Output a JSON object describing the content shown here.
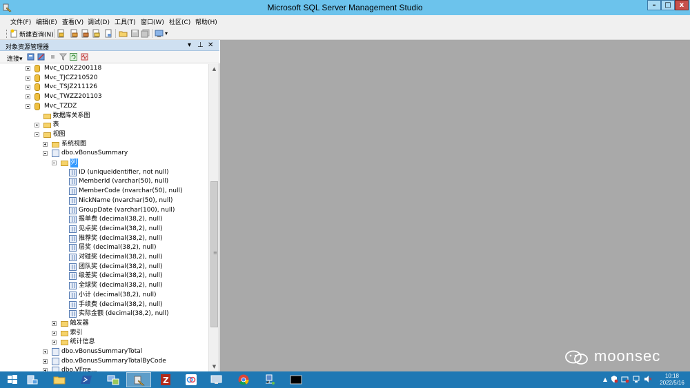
{
  "window": {
    "title": "Microsoft SQL Server Management Studio",
    "minimize_glyph": "–",
    "maximize_glyph": "□",
    "close_glyph": "x"
  },
  "menu": [
    {
      "label": "文件(F)"
    },
    {
      "label": "编辑(E)"
    },
    {
      "label": "查看(V)"
    },
    {
      "label": "调试(D)"
    },
    {
      "label": "工具(T)"
    },
    {
      "label": "窗口(W)"
    },
    {
      "label": "社区(C)"
    },
    {
      "label": "帮助(H)"
    }
  ],
  "toolbar": {
    "new_query_label": "新建查询(N)",
    "overflow_glyph": "▾"
  },
  "object_explorer": {
    "title": "对象资源管理器",
    "pin_glyph": "▾",
    "autohide_glyph": "⊥",
    "close_glyph": "✕",
    "connect_label": "连接▾",
    "tree": [
      {
        "label": "Mvc_QDXZ200118",
        "icon": "database-icon",
        "expander": "plus",
        "level": 0
      },
      {
        "label": "Mvc_TJCZ210520",
        "icon": "database-icon",
        "expander": "plus",
        "level": 0
      },
      {
        "label": "Mvc_TSJZ211126",
        "icon": "database-icon",
        "expander": "plus",
        "level": 0
      },
      {
        "label": "Mvc_TWZZ201103",
        "icon": "database-icon",
        "expander": "plus",
        "level": 0
      },
      {
        "label": "Mvc_TZDZ",
        "icon": "database-icon",
        "expander": "minus",
        "level": 0
      },
      {
        "label": "数据库关系图",
        "icon": "folder-icon",
        "expander": "none",
        "level": 1
      },
      {
        "label": "表",
        "icon": "folder-icon",
        "expander": "plus",
        "level": 1
      },
      {
        "label": "视图",
        "icon": "folder-icon",
        "expander": "minus",
        "level": 1
      },
      {
        "label": "系统视图",
        "icon": "folder-icon",
        "expander": "plus",
        "level": 2
      },
      {
        "label": "dbo.vBonusSummary",
        "icon": "view-icon",
        "expander": "minus",
        "level": 2
      },
      {
        "label": "列",
        "icon": "folder-icon",
        "expander": "minus",
        "level": 3,
        "selected": true
      },
      {
        "label": "ID (uniqueidentifier, not null)",
        "icon": "column-icon",
        "expander": "none",
        "level": 4
      },
      {
        "label": "MemberId (varchar(50), null)",
        "icon": "column-icon",
        "expander": "none",
        "level": 4
      },
      {
        "label": "MemberCode (nvarchar(50), null)",
        "icon": "column-icon",
        "expander": "none",
        "level": 4
      },
      {
        "label": "NickName (nvarchar(50), null)",
        "icon": "column-icon",
        "expander": "none",
        "level": 4
      },
      {
        "label": "GroupDate (varchar(100), null)",
        "icon": "column-icon",
        "expander": "none",
        "level": 4
      },
      {
        "label": "报单费 (decimal(38,2), null)",
        "icon": "column-icon",
        "expander": "none",
        "level": 4
      },
      {
        "label": "见点奖 (decimal(38,2), null)",
        "icon": "column-icon",
        "expander": "none",
        "level": 4
      },
      {
        "label": "推荐奖 (decimal(38,2), null)",
        "icon": "column-icon",
        "expander": "none",
        "level": 4
      },
      {
        "label": "层奖 (decimal(38,2), null)",
        "icon": "column-icon",
        "expander": "none",
        "level": 4
      },
      {
        "label": "对碰奖 (decimal(38,2), null)",
        "icon": "column-icon",
        "expander": "none",
        "level": 4
      },
      {
        "label": "团队奖 (decimal(38,2), null)",
        "icon": "column-icon",
        "expander": "none",
        "level": 4
      },
      {
        "label": "级差奖 (decimal(38,2), null)",
        "icon": "column-icon",
        "expander": "none",
        "level": 4
      },
      {
        "label": "全球奖 (decimal(38,2), null)",
        "icon": "column-icon",
        "expander": "none",
        "level": 4
      },
      {
        "label": "小计 (decimal(38,2), null)",
        "icon": "column-icon",
        "expander": "none",
        "level": 4
      },
      {
        "label": "手续费 (decimal(38,2), null)",
        "icon": "column-icon",
        "expander": "none",
        "level": 4
      },
      {
        "label": "实际金额 (decimal(38,2), null)",
        "icon": "column-icon",
        "expander": "none",
        "level": 4
      },
      {
        "label": "触发器",
        "icon": "folder-icon",
        "expander": "plus",
        "level": 3
      },
      {
        "label": "索引",
        "icon": "folder-icon",
        "expander": "plus",
        "level": 3
      },
      {
        "label": "统计信息",
        "icon": "folder-icon",
        "expander": "plus",
        "level": 3
      },
      {
        "label": "dbo.vBonusSummaryTotal",
        "icon": "view-icon",
        "expander": "plus",
        "level": 2
      },
      {
        "label": "dbo.vBonusSummaryTotalByCode",
        "icon": "view-icon",
        "expander": "plus",
        "level": 2
      },
      {
        "label": "dbo.VFrre...",
        "icon": "view-icon",
        "expander": "plus",
        "level": 2
      }
    ],
    "scroll_up_glyph": "▲",
    "scroll_down_glyph": "▼",
    "scroll_grip_glyph": "≡"
  },
  "watermark": {
    "text": "moonsec"
  },
  "taskbar": {
    "apps": [
      {
        "icon": "start-icon"
      },
      {
        "icon": "server-manager-icon"
      },
      {
        "icon": "file-explorer-icon"
      },
      {
        "icon": "powershell-icon"
      },
      {
        "icon": "network-icon"
      },
      {
        "icon": "ssms-icon",
        "active": true
      },
      {
        "icon": "filezilla-icon"
      },
      {
        "icon": "baidu-netdisk-icon"
      },
      {
        "icon": "remote-desktop-icon"
      },
      {
        "icon": "chrome-icon"
      },
      {
        "icon": "network-tool-icon"
      },
      {
        "icon": "cmd-icon"
      }
    ],
    "tray_expand_glyph": "▲",
    "time": "10:18",
    "date": "2022/5/16"
  },
  "colors": {
    "titlebar": "#6cc3ec",
    "taskbar": "#1f78b4",
    "doc_background": "#a9a9a9",
    "selection": "#3399ff"
  }
}
